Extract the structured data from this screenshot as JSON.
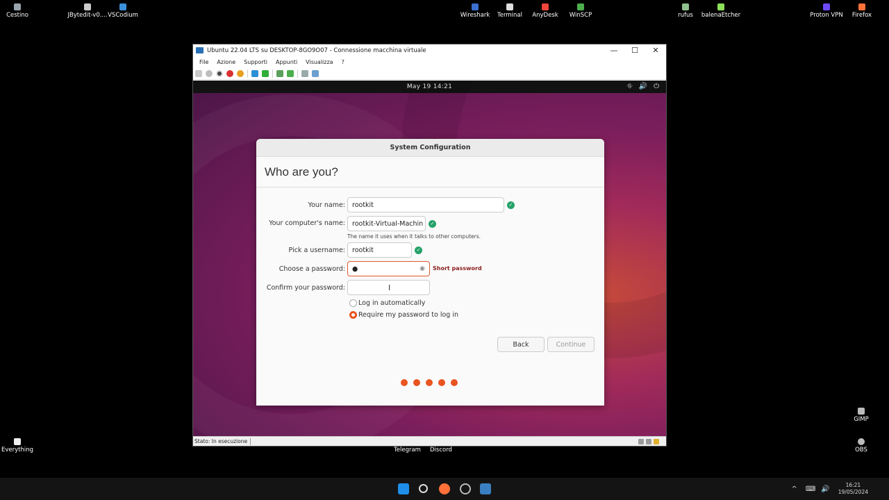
{
  "desktop": {
    "icons_top": [
      {
        "label": "Cestino",
        "icon": "recycle-bin-icon",
        "color": "#9aa4ad"
      },
      {
        "label": "JBytedit-v0....",
        "icon": "file-icon",
        "color": "#cccccc"
      },
      {
        "label": "VSCodium",
        "icon": "vscodium-icon",
        "color": "#3b8fd8"
      },
      {
        "label": "Wireshark",
        "icon": "wireshark-icon",
        "color": "#3a6fd1"
      },
      {
        "label": "Terminal",
        "icon": "terminal-icon",
        "color": "#dddddd"
      },
      {
        "label": "AnyDesk",
        "icon": "anydesk-icon",
        "color": "#ef443b"
      },
      {
        "label": "WinSCP",
        "icon": "winscp-icon",
        "color": "#4cae4c"
      },
      {
        "label": "rufus",
        "icon": "rufus-icon",
        "color": "#8fbf8f"
      },
      {
        "label": "balenaEtcher",
        "icon": "etcher-icon",
        "color": "#8de05a"
      },
      {
        "label": "Proton VPN",
        "icon": "protonvpn-icon",
        "color": "#6d4aff"
      },
      {
        "label": "Firefox",
        "icon": "firefox-icon",
        "color": "#ff7139"
      }
    ],
    "icons_right": [
      {
        "label": "GIMP",
        "icon": "gimp-icon"
      },
      {
        "label": "OBS",
        "icon": "obs-icon"
      }
    ],
    "icon_everything": {
      "label": "Everything",
      "icon": "everything-icon"
    },
    "below_window": [
      "Telegram",
      "Discord"
    ]
  },
  "vm": {
    "window_title": "Ubuntu 22.04 LTS su DESKTOP-8GO9O07 - Connessione macchina virtuale",
    "controls": {
      "minimize": "—",
      "maximize": "☐",
      "close": "✕"
    },
    "menu": [
      "File",
      "Azione",
      "Supporti",
      "Appunti",
      "Visualizza",
      "?"
    ],
    "status_text": "Stato: In esecuzione"
  },
  "ubuntu": {
    "clock": "May 19  14:21",
    "tray": [
      "⛗",
      "🔊",
      "⏻"
    ]
  },
  "dialog": {
    "header": "System Configuration",
    "title": "Who are you?",
    "fields": {
      "name_label": "Your name:",
      "name_value": "rootkit",
      "computer_label": "Your computer's name:",
      "computer_value": "rootkit-Virtual-Machin",
      "computer_hint": "The name it uses when it talks to other computers.",
      "username_label": "Pick a username:",
      "username_value": "rootkit",
      "password_label": "Choose a password:",
      "password_value": "●",
      "password_warning": "Short password",
      "confirm_label": "Confirm your password:",
      "confirm_value": ""
    },
    "login_options": {
      "auto": "Log in automatically",
      "require": "Require my password to log in",
      "selected": "require"
    },
    "buttons": {
      "back": "Back",
      "continue": "Continue"
    },
    "check_mark": "✓",
    "eye": "◉",
    "progress_dots": 5
  },
  "taskbar": {
    "time": "16:21",
    "date": "19/05/2024",
    "tray_glyphs": [
      "^",
      "⌨",
      "🔊"
    ]
  }
}
